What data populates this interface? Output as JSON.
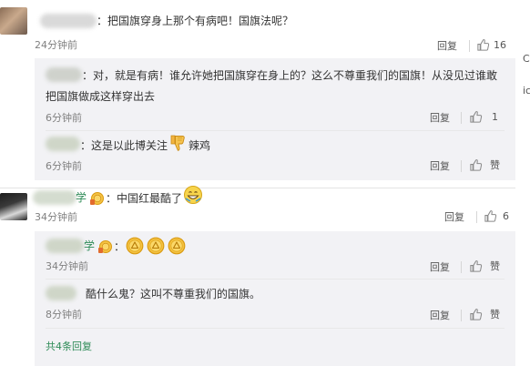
{
  "comments": [
    {
      "text": "：把国旗穿身上那个有病吧！国旗法呢？",
      "time": "24分钟前",
      "reply_label": "回复",
      "likes": "16",
      "replies": [
        {
          "text_line1": "：对，就是有病！谁允许她把国旗穿在身上的？这么不尊重我们的国旗！从没见过谁敢",
          "text_line2": "把国旗做成这样穿出去",
          "time": "6分钟前",
          "reply_label": "回复",
          "likes": "1"
        },
        {
          "text_before": "：这是以此博关注",
          "text_after": "辣鸡",
          "time": "6分钟前",
          "reply_label": "回复",
          "likes": "赞"
        }
      ]
    },
    {
      "name_suffix": "学",
      "text": "：中国红最酷了",
      "time": "34分钟前",
      "reply_label": "回复",
      "likes": "6",
      "replies": [
        {
          "name_suffix": "学",
          "text": "：",
          "time": "34分钟前",
          "reply_label": "回复",
          "likes": "赞"
        },
        {
          "text": "酷什么鬼？这叫不尊重我们的国旗。",
          "time": "8分钟前",
          "reply_label": "回复",
          "likes": "赞"
        }
      ],
      "more_replies": "共4条回复"
    }
  ],
  "right_edge": [
    "C",
    "ic"
  ],
  "colors": {
    "link_green": "#2e8b57",
    "subbox_bg": "#f2f2f5",
    "muted_text": "#808080"
  },
  "icons": [
    "thumbs-up-icon",
    "thumbs-down-emoji",
    "grin-emoji",
    "gold-medal-badge-icon"
  ]
}
